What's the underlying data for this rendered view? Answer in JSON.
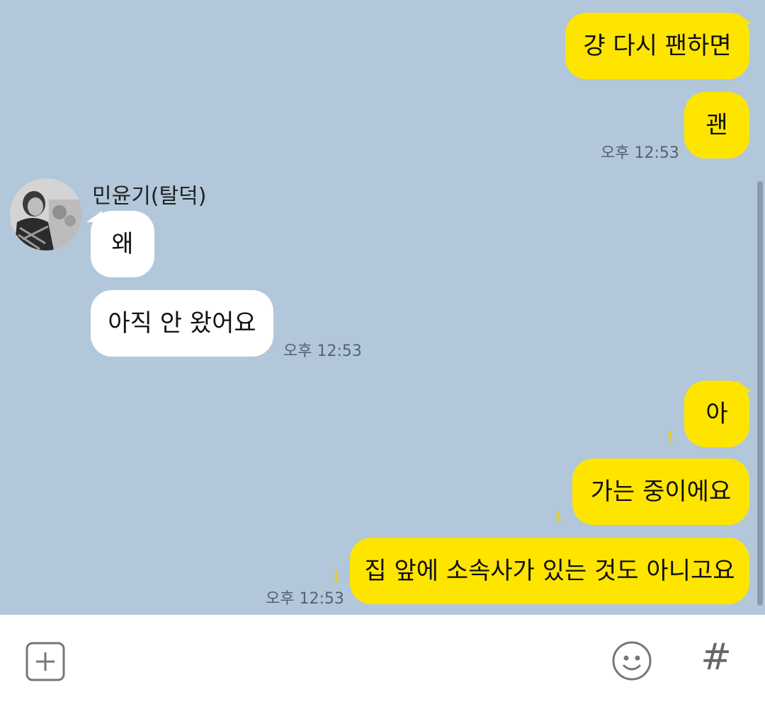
{
  "sender": {
    "name": "민윤기(탈덕)"
  },
  "messages": [
    {
      "text": "걍 다시 팬하면",
      "direction": "out"
    },
    {
      "text": "괜",
      "direction": "out",
      "time": "오후 12:53"
    },
    {
      "text": "왜",
      "direction": "in"
    },
    {
      "text": "아직 안 왔어요",
      "direction": "in",
      "time": "오후 12:53"
    },
    {
      "text": "아",
      "direction": "out",
      "unread": "1"
    },
    {
      "text": "가는 중이에요",
      "direction": "out",
      "unread": "1"
    },
    {
      "text": "집 앞에 소속사가 있는 것도 아니고요",
      "direction": "out",
      "unread": "1",
      "time": "오후 12:53"
    }
  ],
  "input_bar": {
    "icons": [
      "plus-icon",
      "emoji-icon",
      "hash-icon"
    ],
    "hash_glyph": "#"
  },
  "colors": {
    "background": "#b2c7da",
    "outgoing_bubble": "#fee500",
    "incoming_bubble": "#ffffff",
    "unread_count": "#e9cf1c"
  }
}
